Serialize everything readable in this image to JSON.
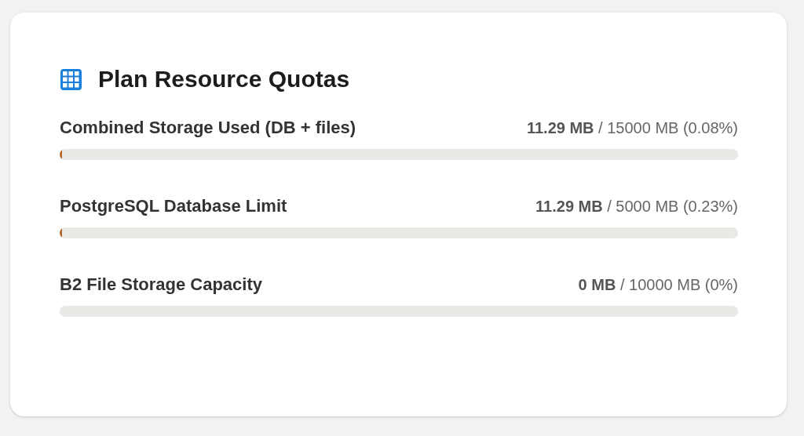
{
  "card": {
    "title": "Plan Resource Quotas",
    "quotas": [
      {
        "label": "Combined Storage Used (DB + files)",
        "reading": "**11.29 MB** / 15000 MB (0.08%)",
        "level": 0.0008
      },
      {
        "label": "PostgreSQL Database Limit",
        "reading": "**11.29 MB** / 5000 MB (0.23%)",
        "level": 0.0023
      },
      {
        "label": "B2 File Storage Capacity",
        "reading": "**0 MB** / 10000 MB (0%)",
        "level": 0
      }
    ]
  }
}
